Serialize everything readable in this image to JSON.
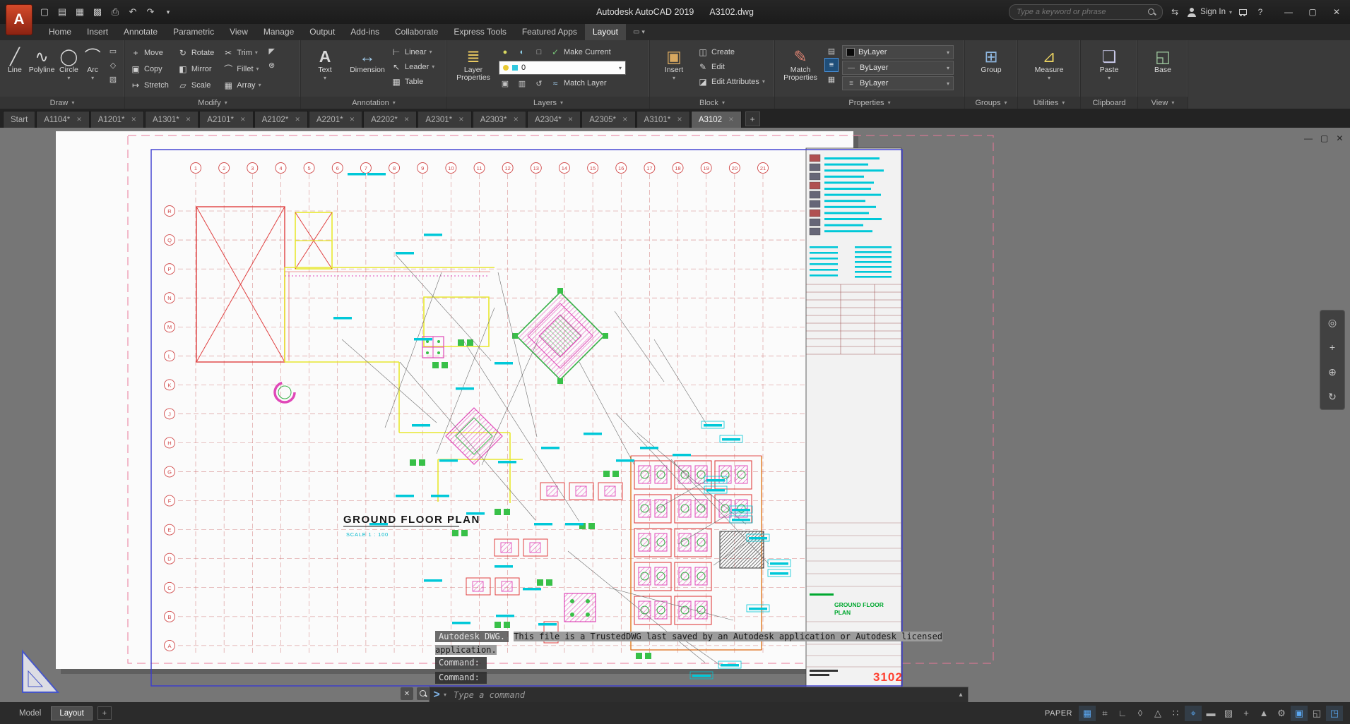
{
  "titlebar": {
    "app_title": "Autodesk AutoCAD 2019",
    "doc_title": "A3102.dwg",
    "search_placeholder": "Type a keyword or phrase",
    "sign_in": "Sign In"
  },
  "ribbon": {
    "tabs": [
      {
        "label": "Home"
      },
      {
        "label": "Insert"
      },
      {
        "label": "Annotate"
      },
      {
        "label": "Parametric"
      },
      {
        "label": "View"
      },
      {
        "label": "Manage"
      },
      {
        "label": "Output"
      },
      {
        "label": "Add-ins"
      },
      {
        "label": "Collaborate"
      },
      {
        "label": "Express Tools"
      },
      {
        "label": "Featured Apps"
      },
      {
        "label": "Layout",
        "active": true
      }
    ],
    "panels": {
      "draw": {
        "label": "Draw",
        "line": "Line",
        "polyline": "Polyline",
        "circle": "Circle",
        "arc": "Arc"
      },
      "modify": {
        "label": "Modify",
        "move": "Move",
        "copy": "Copy",
        "stretch": "Stretch",
        "rotate": "Rotate",
        "mirror": "Mirror",
        "scale": "Scale",
        "trim": "Trim",
        "fillet": "Fillet",
        "array": "Array"
      },
      "annotation": {
        "label": "Annotation",
        "text": "Text",
        "dimension": "Dimension",
        "linear": "Linear",
        "leader": "Leader",
        "table": "Table"
      },
      "layers": {
        "label": "Layers",
        "layer_properties": "Layer Properties",
        "make_current": "Make Current",
        "match_layer": "Match Layer",
        "current_layer": "0"
      },
      "block": {
        "label": "Block",
        "insert": "Insert",
        "create": "Create",
        "edit": "Edit",
        "edit_attributes": "Edit Attributes"
      },
      "properties": {
        "label": "Properties",
        "match_properties": "Match Properties",
        "color_value": "ByLayer",
        "linetype_value": "ByLayer",
        "lineweight_value": "ByLayer"
      },
      "groups": {
        "label": "Groups",
        "group": "Group"
      },
      "utilities": {
        "label": "Utilities",
        "measure": "Measure"
      },
      "clipboard": {
        "label": "Clipboard",
        "paste": "Paste"
      },
      "view": {
        "label": "View",
        "base": "Base"
      }
    }
  },
  "file_tabs": [
    {
      "label": "Start"
    },
    {
      "label": "A1104*"
    },
    {
      "label": "A1201*"
    },
    {
      "label": "A1301*"
    },
    {
      "label": "A2101*"
    },
    {
      "label": "A2102*"
    },
    {
      "label": "A2201*"
    },
    {
      "label": "A2202*"
    },
    {
      "label": "A2301*"
    },
    {
      "label": "A2303*"
    },
    {
      "label": "A2304*"
    },
    {
      "label": "A2305*"
    },
    {
      "label": "A3101*"
    },
    {
      "label": "A3102",
      "active": true
    }
  ],
  "drawing": {
    "grid_columns": [
      "1",
      "2",
      "3",
      "4",
      "5",
      "6",
      "7",
      "8",
      "9",
      "10",
      "11",
      "12",
      "13",
      "14",
      "15",
      "16",
      "17",
      "18",
      "19",
      "20",
      "21"
    ],
    "grid_rows": [
      "R",
      "Q",
      "P",
      "N",
      "M",
      "L",
      "K",
      "J",
      "H",
      "G",
      "F",
      "E",
      "D",
      "C",
      "B",
      "A"
    ],
    "plan_title": "GROUND FLOOR PLAN",
    "plan_scale": "SCALE   1 : 100",
    "sheet_title_line1": "GROUND FLOOR",
    "sheet_title_line2": "PLAN",
    "sheet_number": "3102"
  },
  "command": {
    "message_prefix": "Autodesk DWG.",
    "message_body": "This file is a TrustedDWG last saved by an Autodesk application or Autodesk licensed",
    "message_tail": "application.",
    "history": [
      "Command:",
      "Command:"
    ],
    "prompt_placeholder": "Type a command"
  },
  "bottom": {
    "model": "Model",
    "layout": "Layout",
    "paper": "PAPER"
  },
  "status_icons": [
    {
      "name": "grid-icon",
      "glyph": "▦",
      "active": true
    },
    {
      "name": "snap-icon",
      "glyph": "⌗",
      "active": false
    },
    {
      "name": "ortho-icon",
      "glyph": "∟",
      "active": false
    },
    {
      "name": "polar-tracking-icon",
      "glyph": "◊",
      "active": false
    },
    {
      "name": "isometric-drafting-icon",
      "glyph": "△",
      "active": false
    },
    {
      "name": "osnap-tracking-icon",
      "glyph": "∷",
      "active": false
    },
    {
      "name": "object-snap-icon",
      "glyph": "⌖",
      "active": true
    },
    {
      "name": "lineweight-icon",
      "glyph": "▬",
      "active": false
    },
    {
      "name": "transparency-icon",
      "glyph": "▨",
      "active": false
    },
    {
      "name": "dynamic-input-icon",
      "glyph": "+",
      "active": false
    },
    {
      "name": "annotation-scale-icon",
      "glyph": "▲",
      "active": false
    },
    {
      "name": "customization-gear-icon",
      "glyph": "⚙",
      "active": false
    },
    {
      "name": "annotation-monitor-icon",
      "glyph": "▣",
      "active": true
    },
    {
      "name": "isolate-objects-icon",
      "glyph": "◱",
      "active": false
    },
    {
      "name": "graphics-performance-icon",
      "glyph": "◳",
      "active": true
    }
  ],
  "colors": {
    "accent_blue": "#4a90d8",
    "paper_white": "#fbfbfb",
    "canvas_gray": "#767676",
    "grid_red": "#c86060",
    "wall_yellow": "#e8e830",
    "hatch_magenta": "#e048b8",
    "detail_green": "#38b048",
    "annotation_cyan": "#00c8d8",
    "sheet_number_red": "#ff4030"
  }
}
